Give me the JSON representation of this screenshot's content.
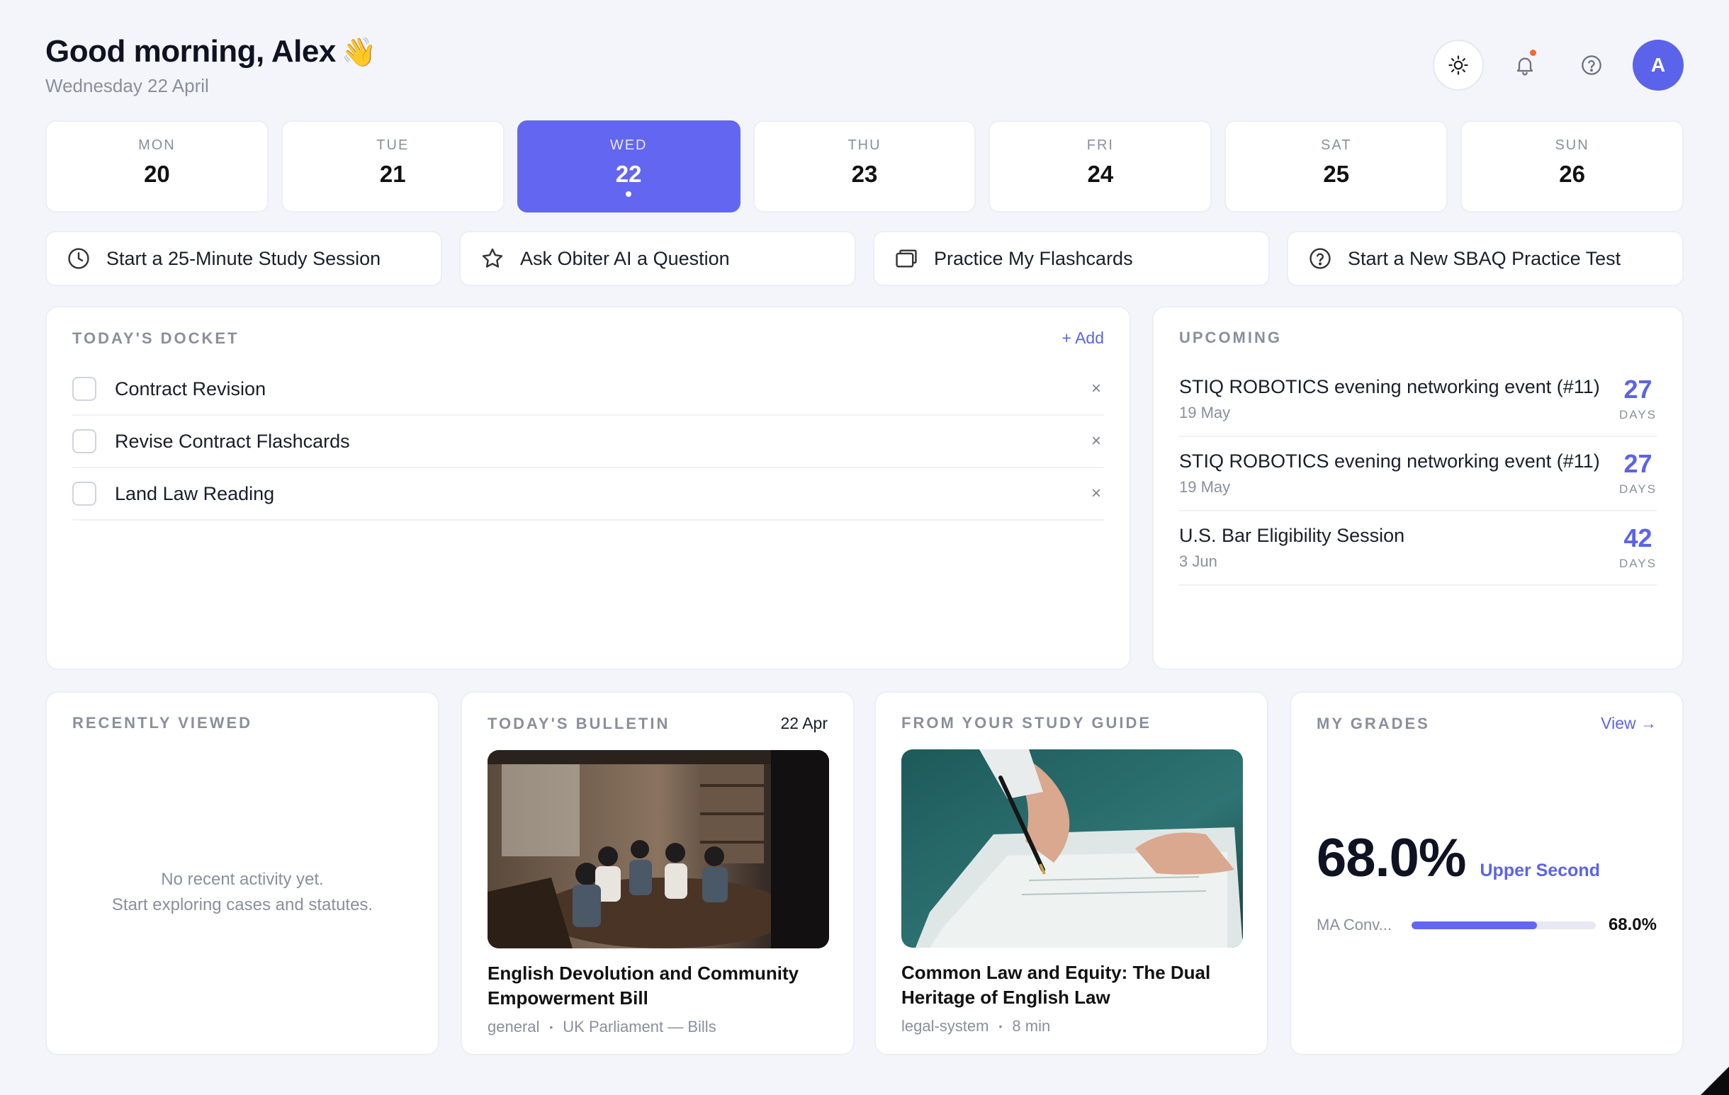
{
  "header": {
    "greeting": "Good morning, Alex",
    "wave": "👋",
    "date": "Wednesday 22 April",
    "avatar_initial": "A",
    "icons": [
      "sun-icon",
      "bell-icon",
      "help-icon"
    ]
  },
  "week": [
    {
      "name": "MON",
      "num": "20",
      "active": false
    },
    {
      "name": "TUE",
      "num": "21",
      "active": false
    },
    {
      "name": "WED",
      "num": "22",
      "active": true
    },
    {
      "name": "THU",
      "num": "23",
      "active": false
    },
    {
      "name": "FRI",
      "num": "24",
      "active": false
    },
    {
      "name": "SAT",
      "num": "25",
      "active": false
    },
    {
      "name": "SUN",
      "num": "26",
      "active": false
    }
  ],
  "actions": [
    {
      "label": "Start a 25-Minute Study Session",
      "icon": "clock-icon"
    },
    {
      "label": "Ask Obiter AI a Question",
      "icon": "star-icon"
    },
    {
      "label": "Practice My Flashcards",
      "icon": "cards-icon"
    },
    {
      "label": "Start a New SBAQ Practice Test",
      "icon": "question-icon"
    }
  ],
  "docket": {
    "title": "TODAY'S DOCKET",
    "add_label": "+ Add",
    "items": [
      {
        "label": "Contract Revision"
      },
      {
        "label": "Revise Contract Flashcards"
      },
      {
        "label": "Land Law Reading"
      }
    ],
    "remove_glyph": "×"
  },
  "upcoming": {
    "title": "UPCOMING",
    "events": [
      {
        "name": "STIQ ROBOTICS evening networking event (#11)",
        "date": "19 May",
        "days": "27",
        "unit": "DAYS"
      },
      {
        "name": "STIQ ROBOTICS evening networking event (#11)",
        "date": "19 May",
        "days": "27",
        "unit": "DAYS"
      },
      {
        "name": "U.S. Bar Eligibility Session",
        "date": "3 Jun",
        "days": "42",
        "unit": "DAYS"
      }
    ]
  },
  "recent": {
    "title": "RECENTLY VIEWED",
    "empty_line1": "No recent activity yet.",
    "empty_line2": "Start exploring cases and statutes."
  },
  "bulletin": {
    "title": "TODAY'S BULLETIN",
    "date": "22 Apr",
    "headline": "English Devolution and Community Empowerment Bill",
    "tag": "general",
    "source": "UK Parliament — Bills"
  },
  "study_guide": {
    "title": "FROM YOUR STUDY GUIDE",
    "headline": "Common Law and Equity: The Dual Heritage of English Law",
    "tag": "legal-system",
    "duration": "8 min"
  },
  "grades": {
    "title": "MY GRADES",
    "view_label": "View →",
    "overall": "68.0%",
    "classification": "Upper Second",
    "modules": [
      {
        "name": "MA Conv...",
        "value": "68.0%",
        "fraction": 0.68
      }
    ]
  },
  "colors": {
    "accent": "#6366f1",
    "notification": "#f26b2b"
  }
}
